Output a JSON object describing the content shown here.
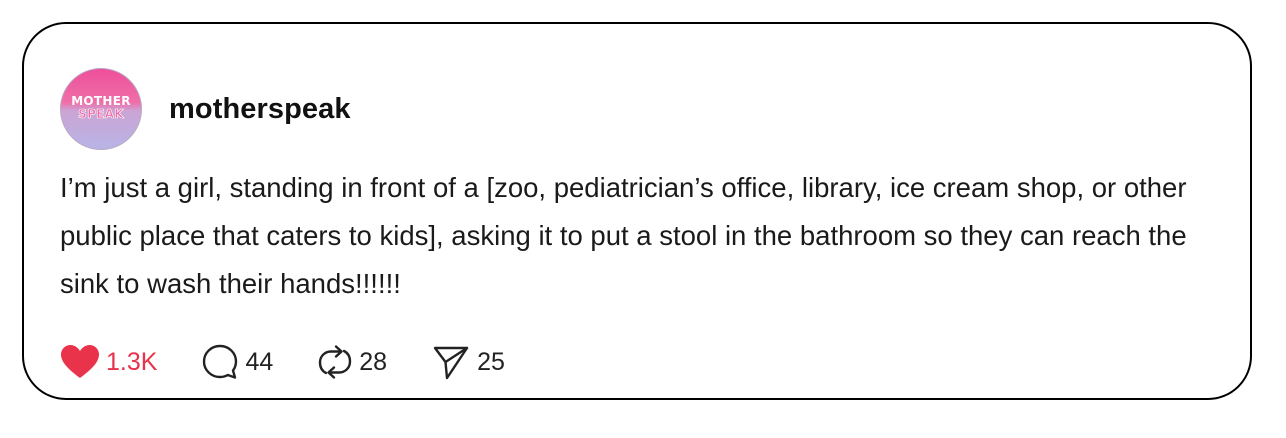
{
  "post": {
    "avatar": {
      "logo_line1": "MOTHER",
      "logo_line2": "SPEAK"
    },
    "username": "motherspeak",
    "text": "I’m just a girl, standing in front of a [zoo, pediatrician’s office, library, ice cream shop, or other public place that caters to kids], asking it to put a stool in the bathroom so they can reach the sink to wash their hands!!!!!!",
    "actions": {
      "likes": {
        "icon": "heart-icon",
        "count": "1.3K",
        "color": "#e8334a",
        "liked": true
      },
      "comments": {
        "icon": "comment-icon",
        "count": "44"
      },
      "reposts": {
        "icon": "repost-icon",
        "count": "28"
      },
      "shares": {
        "icon": "send-icon",
        "count": "25"
      }
    }
  }
}
